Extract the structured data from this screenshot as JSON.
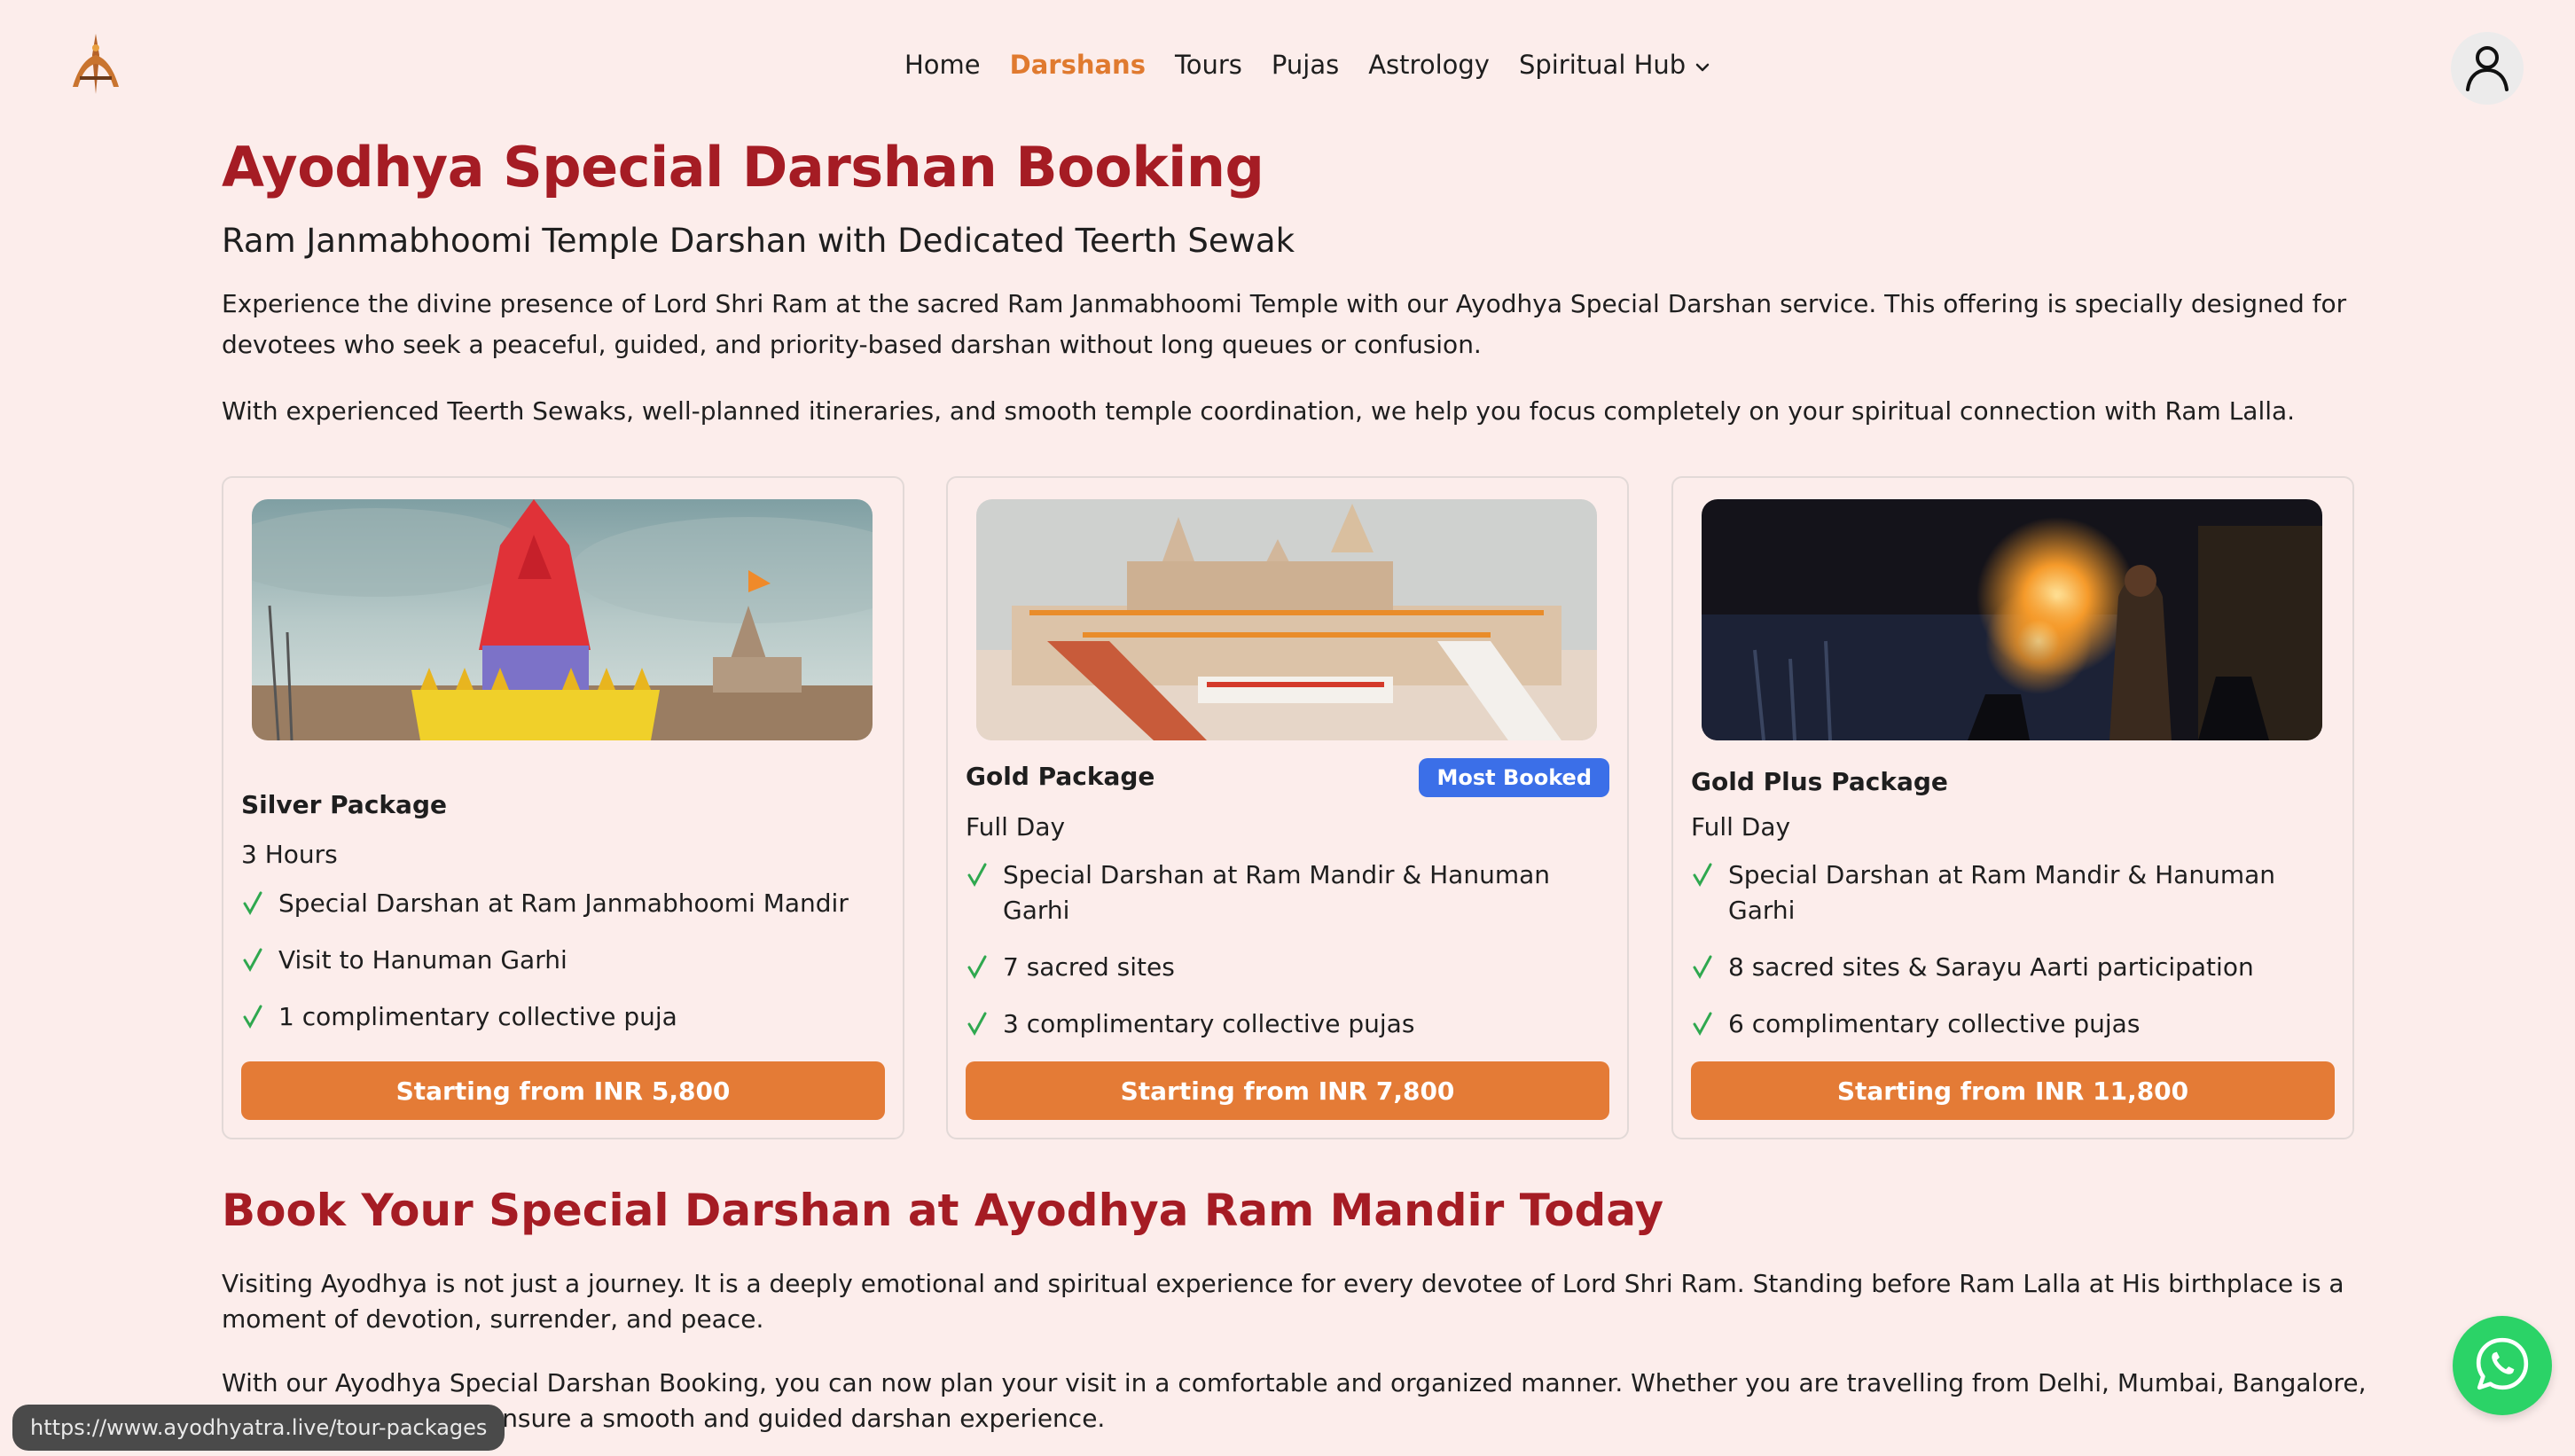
{
  "nav": {
    "items": [
      {
        "label": "Home",
        "active": false
      },
      {
        "label": "Darshans",
        "active": true
      },
      {
        "label": "Tours",
        "active": false
      },
      {
        "label": "Pujas",
        "active": false
      },
      {
        "label": "Astrology",
        "active": false
      },
      {
        "label": "Spiritual Hub",
        "active": false,
        "dropdown": true
      }
    ],
    "icons": {
      "logo": "trishul-logo-icon",
      "dropdown": "chevron-down-icon",
      "account": "user-icon"
    }
  },
  "header": {
    "title": "Ayodhya Special Darshan Booking",
    "subtitle": "Ram Janmabhoomi Temple Darshan with Dedicated Teerth Sewak"
  },
  "intro": {
    "p1": "Experience the divine presence of Lord Shri Ram at the sacred Ram Janmabhoomi Temple with our Ayodhya Special Darshan service. This offering is specially designed for devotees who seek a peaceful, guided, and priority-based darshan without long queues or confusion.",
    "p2": "With experienced Teerth Sewaks, well-planned itineraries, and smooth temple coordination, we help you focus completely on your spiritual connection with Ram Lalla."
  },
  "packages": [
    {
      "name": "Silver Package",
      "duration": "3 Hours",
      "features": [
        "Special Darshan at Ram Janmabhoomi Mandir",
        "Visit to Hanuman Garhi",
        "1 complimentary collective puja"
      ],
      "price_label": "Starting from INR 5,800"
    },
    {
      "name": "Gold Package",
      "badge": "Most Booked",
      "duration": "Full Day",
      "features": [
        "Special Darshan at Ram Mandir & Hanuman Garhi",
        "7 sacred sites",
        "3 complimentary collective pujas"
      ],
      "price_label": "Starting from INR 7,800"
    },
    {
      "name": "Gold Plus Package",
      "duration": "Full Day",
      "features": [
        "Special Darshan at Ram Mandir & Hanuman Garhi",
        "8 sacred sites & Sarayu Aarti participation",
        "6 complimentary collective pujas"
      ],
      "price_label": "Starting from INR 11,800"
    }
  ],
  "booking": {
    "title": "Book Your Special Darshan at Ayodhya Ram Mandir Today",
    "p1": "Visiting Ayodhya is not just a journey. It is a deeply emotional and spiritual experience for every devotee of Lord Shri Ram. Standing before Ram Lalla at His birthplace is a moment of devotion, surrender, and peace.",
    "p2": "With our Ayodhya Special Darshan Booking, you can now plan your visit in a comfortable and organized manner. Whether you are travelling from Delhi, Mumbai, Bangalore, or any other city, we ensure a smooth and guided darshan experience."
  },
  "status_bar": {
    "url": "https://www.ayodhyatra.live/tour-packages"
  },
  "colors": {
    "accent": "#e07a2f",
    "heading": "#a51c24",
    "button": "#e47b36",
    "badge": "#3b6fe8",
    "check": "#2fa84f",
    "background": "#fcedeb",
    "whatsapp": "#2bd367"
  }
}
